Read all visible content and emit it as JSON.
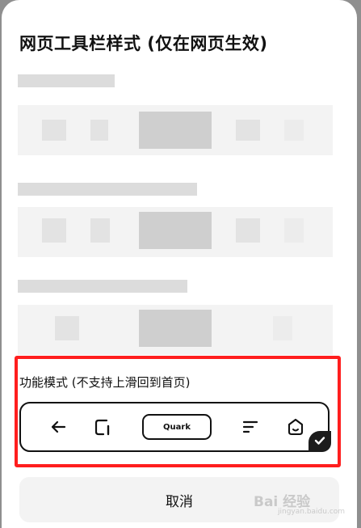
{
  "title": "网页工具栏样式 (仅在网页生效)",
  "mode": {
    "label": "功能模式 (不支持上滑回到首页)",
    "toolbar": {
      "back_icon": "arrow-left-icon",
      "tabs_icon": "tab-switcher-icon",
      "center_label": "Quark",
      "menu_icon": "menu-lines-icon",
      "home_icon": "home-face-icon",
      "selected_icon": "checkmark-icon"
    }
  },
  "cancel_label": "取消",
  "watermark": {
    "text": "Bai 经验",
    "url": "jingyan.baidu.com"
  },
  "colors": {
    "highlight": "#ff1e1e",
    "toolbar_border": "#111111",
    "badge": "#1c1c1c"
  }
}
